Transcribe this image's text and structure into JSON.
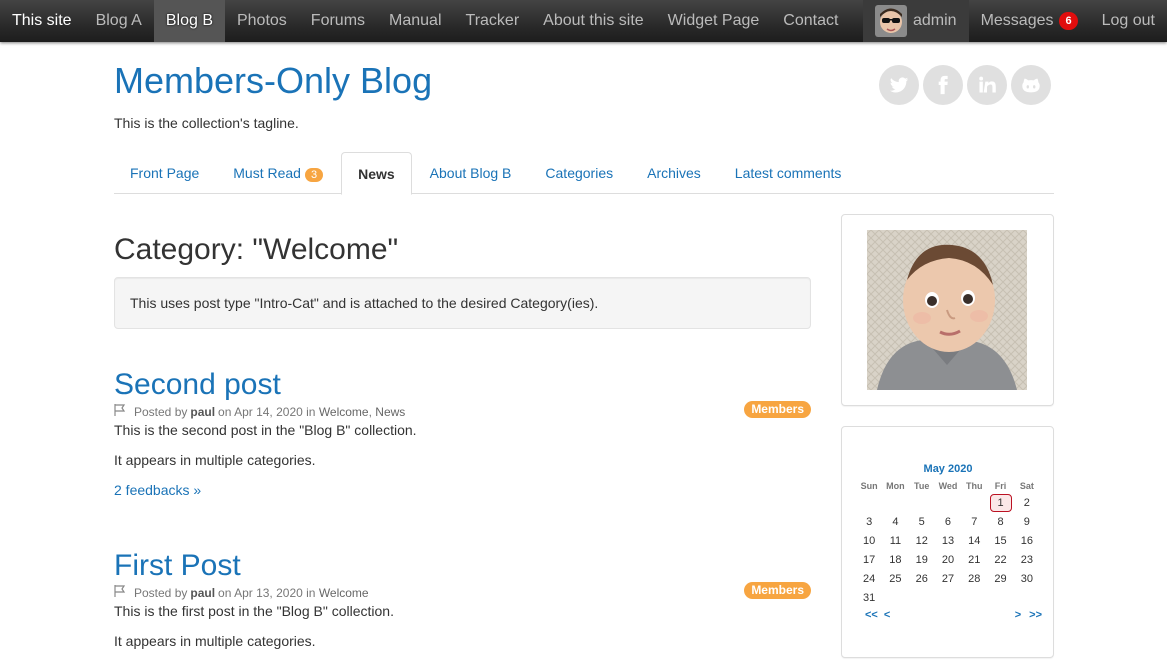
{
  "topbar": {
    "site_label": "This site",
    "nav": [
      "Blog A",
      "Blog B",
      "Photos",
      "Forums",
      "Manual",
      "Tracker",
      "About this site",
      "Widget Page",
      "Contact"
    ],
    "active_nav": "Blog B",
    "user_name": "admin",
    "messages_label": "Messages",
    "messages_count": "6",
    "logout_label": "Log out"
  },
  "header": {
    "title": "Members-Only Blog",
    "tagline": "This is the collection's tagline.",
    "social_icons": [
      "twitter-icon",
      "facebook-icon",
      "linkedin-icon",
      "github-icon"
    ]
  },
  "tabs": [
    {
      "label": "Front Page"
    },
    {
      "label": "Must Read",
      "count": "3"
    },
    {
      "label": "News",
      "active": true
    },
    {
      "label": "About Blog B"
    },
    {
      "label": "Categories"
    },
    {
      "label": "Archives"
    },
    {
      "label": "Latest comments"
    }
  ],
  "main": {
    "category_title": "Category: \"Welcome\"",
    "intro": "This uses post type \"Intro-Cat\" and is attached to the desired Category(ies).",
    "posts": [
      {
        "title": "Second post",
        "posted_by": "Posted by",
        "author": "paul",
        "date_text": "on Apr 14, 2020 in",
        "categories": [
          "Welcome",
          "News"
        ],
        "badge": "Members",
        "paragraphs": [
          "This is the second post in the \"Blog B\" collection.",
          "It appears in multiple categories."
        ],
        "feedback": "2 feedbacks »"
      },
      {
        "title": "First Post",
        "posted_by": "Posted by",
        "author": "paul",
        "date_text": "on Apr 13, 2020 in",
        "categories": [
          "Welcome"
        ],
        "badge": "Members",
        "paragraphs": [
          "This is the first post in the \"Blog B\" collection.",
          "It appears in multiple categories."
        ]
      }
    ]
  },
  "calendar": {
    "title": "May 2020",
    "weekdays": [
      "Sun",
      "Mon",
      "Tue",
      "Wed",
      "Thu",
      "Fri",
      "Sat"
    ],
    "weeks": [
      [
        "",
        "",
        "",
        "",
        "",
        "1",
        "2"
      ],
      [
        "3",
        "4",
        "5",
        "6",
        "7",
        "8",
        "9"
      ],
      [
        "10",
        "11",
        "12",
        "13",
        "14",
        "15",
        "16"
      ],
      [
        "17",
        "18",
        "19",
        "20",
        "21",
        "22",
        "23"
      ],
      [
        "24",
        "25",
        "26",
        "27",
        "28",
        "29",
        "30"
      ],
      [
        "31",
        "",
        "",
        "",
        "",
        "",
        ""
      ]
    ],
    "today": "1",
    "nav": {
      "first": "<<",
      "prev": "<",
      "next": ">",
      "last": ">>"
    }
  },
  "colors": {
    "link": "#1a73b7",
    "badge": "#f7a541",
    "alert": "#e10d0d"
  }
}
